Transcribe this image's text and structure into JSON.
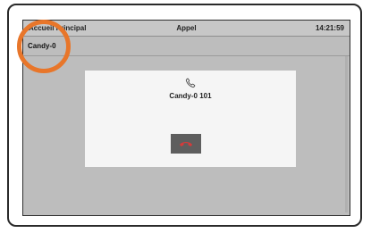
{
  "header": {
    "left_title": "Accueil Principal",
    "center_title": "Appel",
    "time": "14:21:59"
  },
  "subheader": {
    "contact_label": "Candy-0"
  },
  "dialog": {
    "icon": "phone-icon",
    "caller": "Candy-0 101",
    "hangup_icon": "phone-hangup-icon"
  },
  "colors": {
    "screen_bg": "#bdbdbd",
    "dialog_bg": "#f5f5f5",
    "hangup_bg": "#5e5e5e",
    "hangup_icon": "#d63a3a",
    "highlight_ring": "#e8762a"
  }
}
